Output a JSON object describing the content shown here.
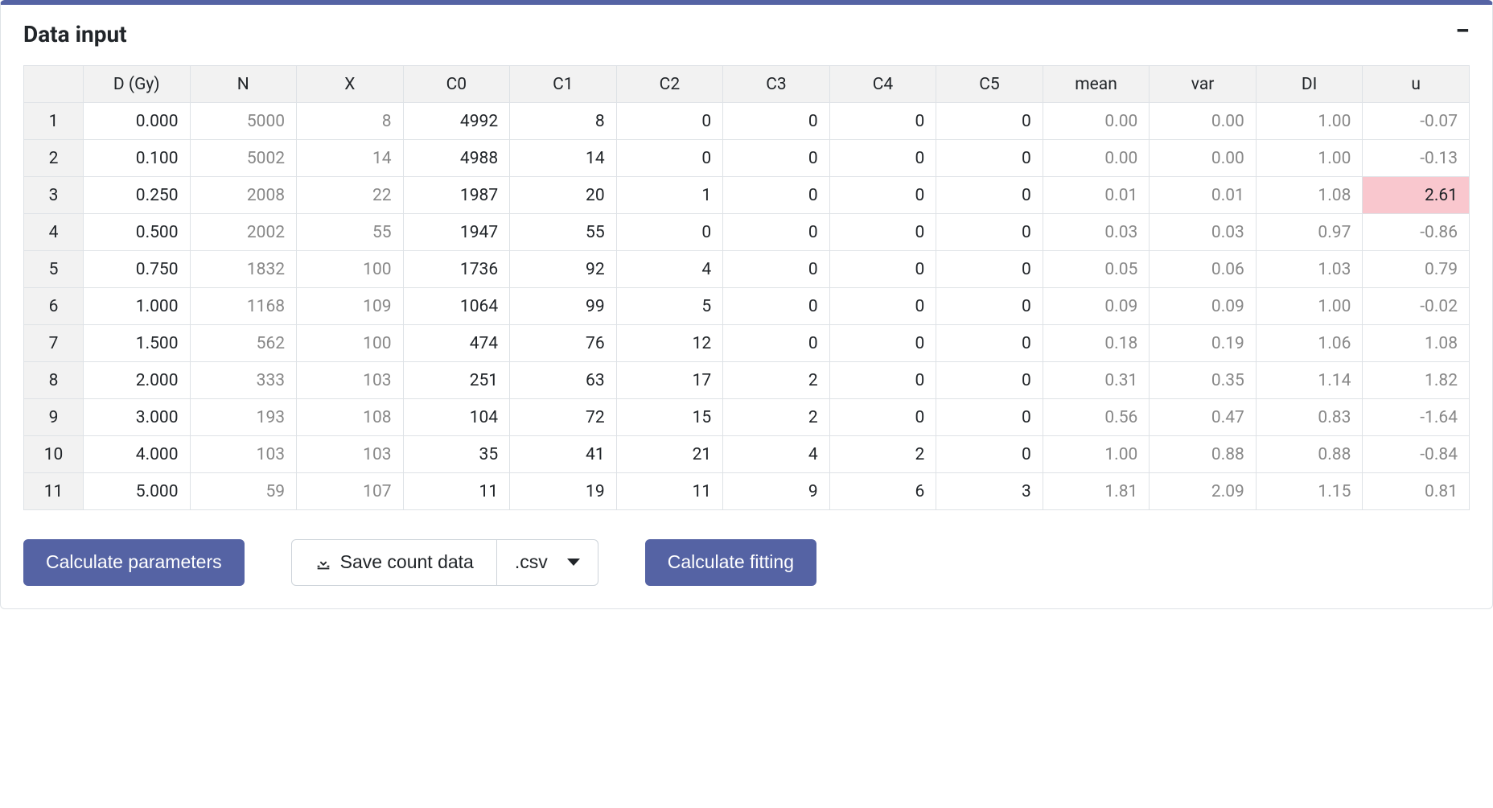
{
  "panel": {
    "title": "Data input"
  },
  "table": {
    "headers": [
      "",
      "D (Gy)",
      "N",
      "X",
      "C0",
      "C1",
      "C2",
      "C3",
      "C4",
      "C5",
      "mean",
      "var",
      "DI",
      "u"
    ],
    "rows": [
      {
        "num": "1",
        "d": "0.000",
        "n": "5000",
        "x": "8",
        "c0": "4992",
        "c1": "8",
        "c2": "0",
        "c3": "0",
        "c4": "0",
        "c5": "0",
        "mean": "0.00",
        "var": "0.00",
        "di": "1.00",
        "u": "-0.07",
        "u_hl": false
      },
      {
        "num": "2",
        "d": "0.100",
        "n": "5002",
        "x": "14",
        "c0": "4988",
        "c1": "14",
        "c2": "0",
        "c3": "0",
        "c4": "0",
        "c5": "0",
        "mean": "0.00",
        "var": "0.00",
        "di": "1.00",
        "u": "-0.13",
        "u_hl": false
      },
      {
        "num": "3",
        "d": "0.250",
        "n": "2008",
        "x": "22",
        "c0": "1987",
        "c1": "20",
        "c2": "1",
        "c3": "0",
        "c4": "0",
        "c5": "0",
        "mean": "0.01",
        "var": "0.01",
        "di": "1.08",
        "u": "2.61",
        "u_hl": true
      },
      {
        "num": "4",
        "d": "0.500",
        "n": "2002",
        "x": "55",
        "c0": "1947",
        "c1": "55",
        "c2": "0",
        "c3": "0",
        "c4": "0",
        "c5": "0",
        "mean": "0.03",
        "var": "0.03",
        "di": "0.97",
        "u": "-0.86",
        "u_hl": false
      },
      {
        "num": "5",
        "d": "0.750",
        "n": "1832",
        "x": "100",
        "c0": "1736",
        "c1": "92",
        "c2": "4",
        "c3": "0",
        "c4": "0",
        "c5": "0",
        "mean": "0.05",
        "var": "0.06",
        "di": "1.03",
        "u": "0.79",
        "u_hl": false
      },
      {
        "num": "6",
        "d": "1.000",
        "n": "1168",
        "x": "109",
        "c0": "1064",
        "c1": "99",
        "c2": "5",
        "c3": "0",
        "c4": "0",
        "c5": "0",
        "mean": "0.09",
        "var": "0.09",
        "di": "1.00",
        "u": "-0.02",
        "u_hl": false
      },
      {
        "num": "7",
        "d": "1.500",
        "n": "562",
        "x": "100",
        "c0": "474",
        "c1": "76",
        "c2": "12",
        "c3": "0",
        "c4": "0",
        "c5": "0",
        "mean": "0.18",
        "var": "0.19",
        "di": "1.06",
        "u": "1.08",
        "u_hl": false
      },
      {
        "num": "8",
        "d": "2.000",
        "n": "333",
        "x": "103",
        "c0": "251",
        "c1": "63",
        "c2": "17",
        "c3": "2",
        "c4": "0",
        "c5": "0",
        "mean": "0.31",
        "var": "0.35",
        "di": "1.14",
        "u": "1.82",
        "u_hl": false
      },
      {
        "num": "9",
        "d": "3.000",
        "n": "193",
        "x": "108",
        "c0": "104",
        "c1": "72",
        "c2": "15",
        "c3": "2",
        "c4": "0",
        "c5": "0",
        "mean": "0.56",
        "var": "0.47",
        "di": "0.83",
        "u": "-1.64",
        "u_hl": false
      },
      {
        "num": "10",
        "d": "4.000",
        "n": "103",
        "x": "103",
        "c0": "35",
        "c1": "41",
        "c2": "21",
        "c3": "4",
        "c4": "2",
        "c5": "0",
        "mean": "1.00",
        "var": "0.88",
        "di": "0.88",
        "u": "-0.84",
        "u_hl": false
      },
      {
        "num": "11",
        "d": "5.000",
        "n": "59",
        "x": "107",
        "c0": "11",
        "c1": "19",
        "c2": "11",
        "c3": "9",
        "c4": "6",
        "c5": "3",
        "mean": "1.81",
        "var": "2.09",
        "di": "1.15",
        "u": "0.81",
        "u_hl": false
      }
    ]
  },
  "toolbar": {
    "calc_params_label": "Calculate parameters",
    "save_count_label": "Save count data",
    "format_label": ".csv",
    "calc_fitting_label": "Calculate fitting"
  }
}
